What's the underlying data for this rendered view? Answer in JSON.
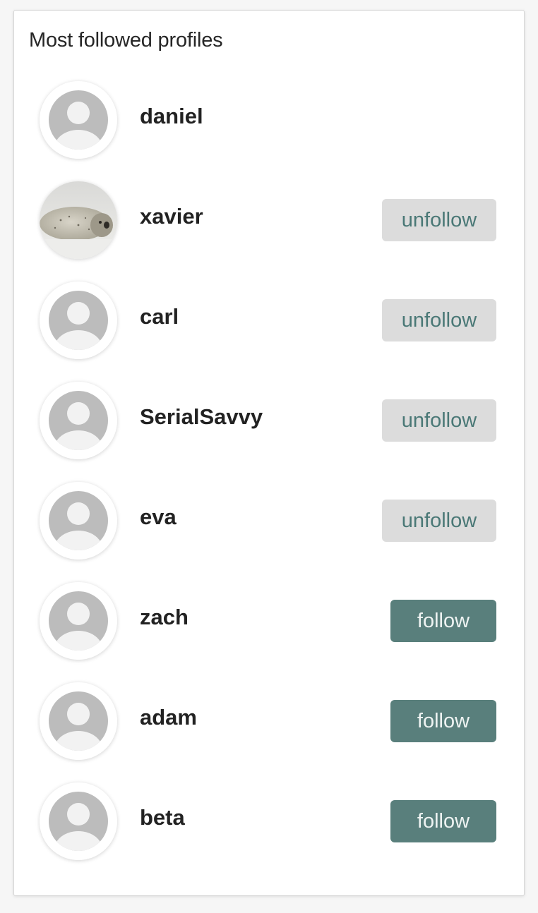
{
  "panel": {
    "title": "Most followed profiles"
  },
  "colors": {
    "follow_bg": "#597f7c",
    "follow_text": "#eef3f2",
    "unfollow_bg": "#dcdcdc",
    "unfollow_text": "#4a7876",
    "avatar_placeholder": "#bcbcbc"
  },
  "profiles": [
    {
      "name": "daniel",
      "avatar": "default-avatar-icon",
      "button": null
    },
    {
      "name": "xavier",
      "avatar": "seal-photo",
      "button": "unfollow"
    },
    {
      "name": "carl",
      "avatar": "default-avatar-icon",
      "button": "unfollow"
    },
    {
      "name": "SerialSavvy",
      "avatar": "default-avatar-icon",
      "button": "unfollow"
    },
    {
      "name": "eva",
      "avatar": "default-avatar-icon",
      "button": "unfollow"
    },
    {
      "name": "zach",
      "avatar": "default-avatar-icon",
      "button": "follow"
    },
    {
      "name": "adam",
      "avatar": "default-avatar-icon",
      "button": "follow"
    },
    {
      "name": "beta",
      "avatar": "default-avatar-icon",
      "button": "follow"
    }
  ]
}
